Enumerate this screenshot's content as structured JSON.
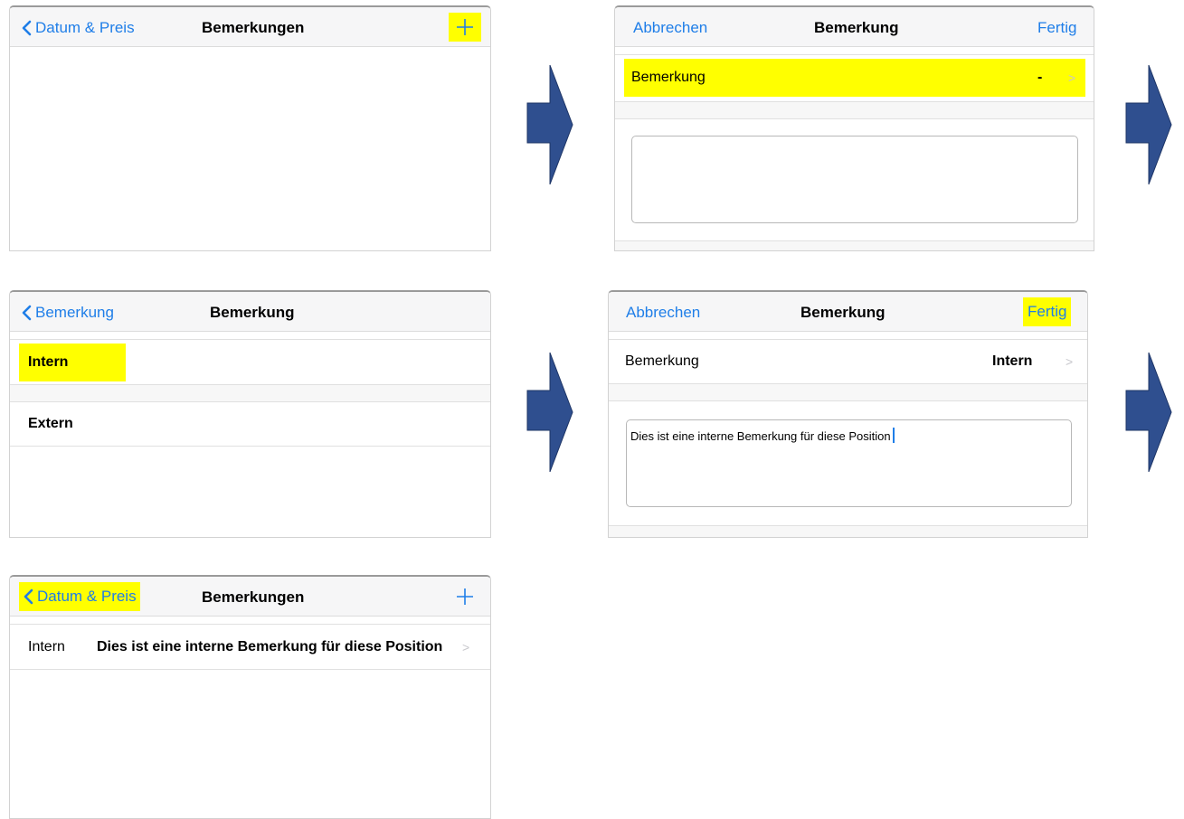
{
  "colors": {
    "accent": "#1f7ee8",
    "highlight": "#ffff00",
    "arrow": "#2f4f8f"
  },
  "screen1": {
    "back_label": "Datum & Preis",
    "title": "Bemerkungen",
    "add_icon": "plus-icon"
  },
  "screen2": {
    "cancel_label": "Abbrechen",
    "title": "Bemerkung",
    "done_label": "Fertig",
    "row_label": "Bemerkung",
    "row_value": "-",
    "text_value": ""
  },
  "screen3": {
    "back_label": "Bemerkung",
    "title": "Bemerkung",
    "options": [
      "Intern",
      "Extern"
    ]
  },
  "screen4": {
    "cancel_label": "Abbrechen",
    "title": "Bemerkung",
    "done_label": "Fertig",
    "row_label": "Bemerkung",
    "row_value": "Intern",
    "text_value": "Dies ist eine interne Bemerkung für diese Position"
  },
  "screen5": {
    "back_label": "Datum & Preis",
    "title": "Bemerkungen",
    "add_icon": "plus-icon",
    "items": [
      {
        "type": "Intern",
        "text": "Dies ist eine interne Bemerkung für diese Position"
      }
    ]
  }
}
